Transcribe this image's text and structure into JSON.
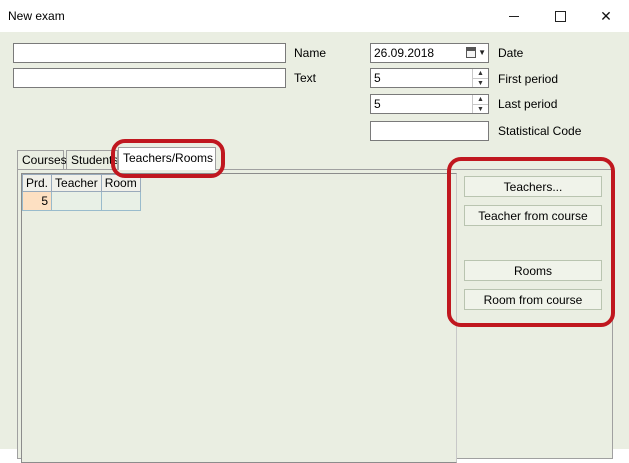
{
  "window": {
    "title": "New exam",
    "minimize_icon": "minimize-icon",
    "maximize_icon": "maximize-icon",
    "close_icon": "close-icon",
    "close_glyph": "✕"
  },
  "form": {
    "name": {
      "label": "Name",
      "value": ""
    },
    "text": {
      "label": "Text",
      "value": ""
    },
    "date": {
      "label": "Date",
      "value": "26.09.2018",
      "icon": "calendar-icon"
    },
    "first_period": {
      "label": "First period",
      "value": "5"
    },
    "last_period": {
      "label": "Last period",
      "value": "5"
    },
    "statistical_code": {
      "label": "Statistical Code",
      "value": ""
    }
  },
  "tabs": [
    {
      "label": "Courses",
      "active": false
    },
    {
      "label": "Students",
      "active": false
    },
    {
      "label": "Teachers/Rooms",
      "active": true
    }
  ],
  "grid": {
    "columns": [
      "Prd.",
      "Teacher",
      "Room"
    ],
    "rows": [
      [
        "5",
        "",
        ""
      ]
    ]
  },
  "buttons": {
    "teachers": "Teachers...",
    "teacher_from_course": "Teacher from course",
    "rooms": "Rooms",
    "room_from_course": "Room from course"
  },
  "annotation_color": "#c0171f"
}
